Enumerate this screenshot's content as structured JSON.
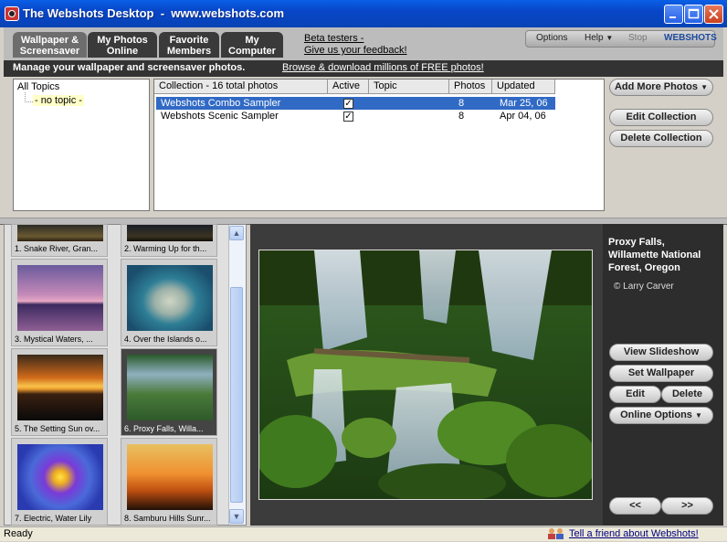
{
  "window": {
    "title": "The Webshots Desktop  -  www.webshots.com",
    "controls": [
      "minimize",
      "maximize",
      "close"
    ]
  },
  "tabs": [
    {
      "line1": "Wallpaper &",
      "line2": "Screensaver",
      "active": true
    },
    {
      "line1": "My Photos",
      "line2": "Online",
      "active": false
    },
    {
      "line1": "Favorite",
      "line2": "Members",
      "active": false
    },
    {
      "line1": "My",
      "line2": "Computer",
      "active": false
    }
  ],
  "beta": {
    "line1": "Beta testers -",
    "line2": "Give us your feedback!"
  },
  "menu": {
    "options": "Options",
    "help": "Help",
    "stop": "Stop",
    "brand": "WEBSHOTS"
  },
  "header": {
    "title": "Manage your wallpaper and screensaver photos.",
    "link": "Browse & download millions of FREE photos!"
  },
  "topics": {
    "root": "All Topics",
    "child": "- no topic -"
  },
  "collections": {
    "columns": [
      "Collection - 16 total photos",
      "Active",
      "Topic",
      "Photos",
      "Updated"
    ],
    "rows": [
      {
        "name": "Webshots Combo Sampler",
        "active": true,
        "topic": "",
        "photos": "8",
        "updated": "Mar 25, 06",
        "selected": true
      },
      {
        "name": "Webshots Scenic Sampler",
        "active": true,
        "topic": "",
        "photos": "8",
        "updated": "Apr 04, 06",
        "selected": false
      }
    ]
  },
  "collection_buttons": {
    "add": "Add More Photos",
    "edit": "Edit Collection",
    "delete": "Delete Collection"
  },
  "thumbnails": [
    {
      "caption": "1. Snake River, Gran...",
      "selected": false
    },
    {
      "caption": "2. Warming Up for th...",
      "selected": false
    },
    {
      "caption": "3. Mystical Waters, ...",
      "selected": false
    },
    {
      "caption": "4. Over the Islands o...",
      "selected": false
    },
    {
      "caption": "5. The Setting Sun ov...",
      "selected": false
    },
    {
      "caption": "6. Proxy Falls, Willa...",
      "selected": true
    },
    {
      "caption": "7. Electric, Water Lily",
      "selected": false
    },
    {
      "caption": "8. Samburu Hills Sunr...",
      "selected": false
    }
  ],
  "viewer": {
    "title_line1": "Proxy Falls,",
    "title_line2": "Willamette National",
    "title_line3": "Forest, Oregon",
    "credit": "© Larry Carver",
    "buttons": {
      "slideshow": "View Slideshow",
      "wallpaper": "Set Wallpaper",
      "edit": "Edit",
      "delete": "Delete",
      "online": "Online Options",
      "prev": "<<",
      "next": ">>"
    }
  },
  "status": {
    "text": "Ready",
    "tell_friend": "Tell a friend about Webshots!"
  }
}
